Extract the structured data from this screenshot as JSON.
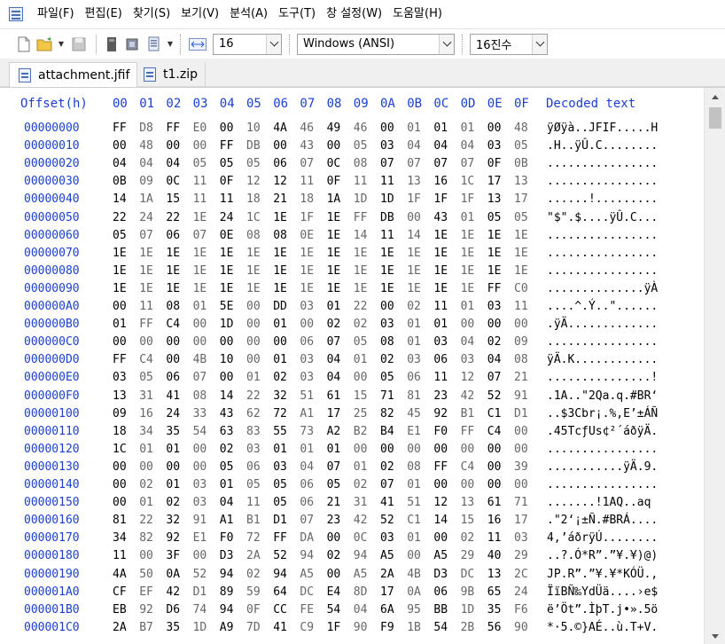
{
  "menu": [
    "파일(F)",
    "편집(E)",
    "찾기(S)",
    "보기(V)",
    "분석(A)",
    "도구(T)",
    "창 설정(W)",
    "도움말(H)"
  ],
  "toolbar": {
    "bytes_per_row": "16",
    "charset": "Windows (ANSI)",
    "offset_base": "16진수"
  },
  "tabs": [
    "attachment.jfif",
    "t1.zip"
  ],
  "hex": {
    "header": {
      "offset_label": "Offset(h)",
      "columns": [
        "00",
        "01",
        "02",
        "03",
        "04",
        "05",
        "06",
        "07",
        "08",
        "09",
        "0A",
        "0B",
        "0C",
        "0D",
        "0E",
        "0F"
      ],
      "decoded_label": "Decoded text"
    },
    "rows": [
      {
        "offset": "00000000",
        "bytes": [
          "FF",
          "D8",
          "FF",
          "E0",
          "00",
          "10",
          "4A",
          "46",
          "49",
          "46",
          "00",
          "01",
          "01",
          "01",
          "00",
          "48"
        ],
        "text": "ÿØÿà..JFIF.....H"
      },
      {
        "offset": "00000010",
        "bytes": [
          "00",
          "48",
          "00",
          "00",
          "FF",
          "DB",
          "00",
          "43",
          "00",
          "05",
          "03",
          "04",
          "04",
          "04",
          "03",
          "05"
        ],
        "text": ".H..ÿÛ.C........"
      },
      {
        "offset": "00000020",
        "bytes": [
          "04",
          "04",
          "04",
          "05",
          "05",
          "05",
          "06",
          "07",
          "0C",
          "08",
          "07",
          "07",
          "07",
          "07",
          "0F",
          "0B"
        ],
        "text": "................"
      },
      {
        "offset": "00000030",
        "bytes": [
          "0B",
          "09",
          "0C",
          "11",
          "0F",
          "12",
          "12",
          "11",
          "0F",
          "11",
          "11",
          "13",
          "16",
          "1C",
          "17",
          "13"
        ],
        "text": "................"
      },
      {
        "offset": "00000040",
        "bytes": [
          "14",
          "1A",
          "15",
          "11",
          "11",
          "18",
          "21",
          "18",
          "1A",
          "1D",
          "1D",
          "1F",
          "1F",
          "1F",
          "13",
          "17"
        ],
        "text": "......!........."
      },
      {
        "offset": "00000050",
        "bytes": [
          "22",
          "24",
          "22",
          "1E",
          "24",
          "1C",
          "1E",
          "1F",
          "1E",
          "FF",
          "DB",
          "00",
          "43",
          "01",
          "05",
          "05"
        ],
        "text": "\"$\".$....ÿÛ.C..."
      },
      {
        "offset": "00000060",
        "bytes": [
          "05",
          "07",
          "06",
          "07",
          "0E",
          "08",
          "08",
          "0E",
          "1E",
          "14",
          "11",
          "14",
          "1E",
          "1E",
          "1E",
          "1E"
        ],
        "text": "................"
      },
      {
        "offset": "00000070",
        "bytes": [
          "1E",
          "1E",
          "1E",
          "1E",
          "1E",
          "1E",
          "1E",
          "1E",
          "1E",
          "1E",
          "1E",
          "1E",
          "1E",
          "1E",
          "1E",
          "1E"
        ],
        "text": "................"
      },
      {
        "offset": "00000080",
        "bytes": [
          "1E",
          "1E",
          "1E",
          "1E",
          "1E",
          "1E",
          "1E",
          "1E",
          "1E",
          "1E",
          "1E",
          "1E",
          "1E",
          "1E",
          "1E",
          "1E"
        ],
        "text": "................"
      },
      {
        "offset": "00000090",
        "bytes": [
          "1E",
          "1E",
          "1E",
          "1E",
          "1E",
          "1E",
          "1E",
          "1E",
          "1E",
          "1E",
          "1E",
          "1E",
          "1E",
          "1E",
          "FF",
          "C0"
        ],
        "text": "..............ÿÀ"
      },
      {
        "offset": "000000A0",
        "bytes": [
          "00",
          "11",
          "08",
          "01",
          "5E",
          "00",
          "DD",
          "03",
          "01",
          "22",
          "00",
          "02",
          "11",
          "01",
          "03",
          "11"
        ],
        "text": "....^.Ý..\"......"
      },
      {
        "offset": "000000B0",
        "bytes": [
          "01",
          "FF",
          "C4",
          "00",
          "1D",
          "00",
          "01",
          "00",
          "02",
          "02",
          "03",
          "01",
          "01",
          "00",
          "00",
          "00"
        ],
        "text": ".ÿÄ............."
      },
      {
        "offset": "000000C0",
        "bytes": [
          "00",
          "00",
          "00",
          "00",
          "00",
          "00",
          "00",
          "06",
          "07",
          "05",
          "08",
          "01",
          "03",
          "04",
          "02",
          "09"
        ],
        "text": "................"
      },
      {
        "offset": "000000D0",
        "bytes": [
          "FF",
          "C4",
          "00",
          "4B",
          "10",
          "00",
          "01",
          "03",
          "04",
          "01",
          "02",
          "03",
          "06",
          "03",
          "04",
          "08"
        ],
        "text": "ÿÄ.K............"
      },
      {
        "offset": "000000E0",
        "bytes": [
          "03",
          "05",
          "06",
          "07",
          "00",
          "01",
          "02",
          "03",
          "04",
          "00",
          "05",
          "06",
          "11",
          "12",
          "07",
          "21"
        ],
        "text": "...............!"
      },
      {
        "offset": "000000F0",
        "bytes": [
          "13",
          "31",
          "41",
          "08",
          "14",
          "22",
          "32",
          "51",
          "61",
          "15",
          "71",
          "81",
          "23",
          "42",
          "52",
          "91"
        ],
        "text": ".1A..\"2Qa.q.#BR‘"
      },
      {
        "offset": "00000100",
        "bytes": [
          "09",
          "16",
          "24",
          "33",
          "43",
          "62",
          "72",
          "A1",
          "17",
          "25",
          "82",
          "45",
          "92",
          "B1",
          "C1",
          "D1"
        ],
        "text": "..$3Cbr¡.%‚E’±ÁÑ"
      },
      {
        "offset": "00000110",
        "bytes": [
          "18",
          "34",
          "35",
          "54",
          "63",
          "83",
          "55",
          "73",
          "A2",
          "B2",
          "B4",
          "E1",
          "F0",
          "FF",
          "C4",
          "00"
        ],
        "text": ".45TcƒUs¢²´áðÿÄ."
      },
      {
        "offset": "00000120",
        "bytes": [
          "1C",
          "01",
          "01",
          "00",
          "02",
          "03",
          "01",
          "01",
          "01",
          "00",
          "00",
          "00",
          "00",
          "00",
          "00",
          "00"
        ],
        "text": "................"
      },
      {
        "offset": "00000130",
        "bytes": [
          "00",
          "00",
          "00",
          "00",
          "05",
          "06",
          "03",
          "04",
          "07",
          "01",
          "02",
          "08",
          "FF",
          "C4",
          "00",
          "39",
          "11"
        ],
        "text": "...........ÿÄ.9."
      },
      {
        "offset": "00000140",
        "bytes": [
          "00",
          "02",
          "01",
          "03",
          "01",
          "05",
          "05",
          "06",
          "05",
          "02",
          "07",
          "01",
          "00",
          "00",
          "00",
          "00"
        ],
        "text": "................"
      },
      {
        "offset": "00000150",
        "bytes": [
          "00",
          "01",
          "02",
          "03",
          "04",
          "11",
          "05",
          "06",
          "21",
          "31",
          "41",
          "51",
          "12",
          "13",
          "61",
          "71"
        ],
        "text": ".......!1AQ..aq"
      },
      {
        "offset": "00000160",
        "bytes": [
          "81",
          "22",
          "32",
          "91",
          "A1",
          "B1",
          "D1",
          "07",
          "23",
          "42",
          "52",
          "C1",
          "14",
          "15",
          "16",
          "17"
        ],
        "text": ".\"2‘¡±Ñ.#BRÁ...."
      },
      {
        "offset": "00000170",
        "bytes": [
          "34",
          "82",
          "92",
          "E1",
          "F0",
          "72",
          "FF",
          "DA",
          "00",
          "0C",
          "03",
          "01",
          "00",
          "02",
          "11",
          "03"
        ],
        "text": "4‚’áðrÿÚ........"
      },
      {
        "offset": "00000180",
        "bytes": [
          "11",
          "00",
          "3F",
          "00",
          "D3",
          "2A",
          "52",
          "94",
          "02",
          "94",
          "A5",
          "00",
          "A5",
          "29",
          "40",
          "29"
        ],
        "text": "..?.Ó*R”.”¥.¥)@)"
      },
      {
        "offset": "00000190",
        "bytes": [
          "4A",
          "50",
          "0A",
          "52",
          "94",
          "02",
          "94",
          "A5",
          "00",
          "A5",
          "2A",
          "4B",
          "D3",
          "DC",
          "13",
          "2C"
        ],
        "text": "JP.R”.”¥.¥*KÓÜ.,"
      },
      {
        "offset": "000001A0",
        "bytes": [
          "CF",
          "EF",
          "42",
          "D1",
          "89",
          "59",
          "64",
          "DC",
          "E4",
          "8D",
          "17",
          "0A",
          "06",
          "9B",
          "65",
          "24"
        ],
        "text": "ÏïBÑ‰YdÜä....›e$"
      },
      {
        "offset": "000001B0",
        "bytes": [
          "EB",
          "92",
          "D6",
          "74",
          "94",
          "0F",
          "CC",
          "FE",
          "54",
          "04",
          "6A",
          "95",
          "BB",
          "1D",
          "35",
          "F6"
        ],
        "text": "ë’Öt”.ÌþT.j•».5ö"
      },
      {
        "offset": "000001C0",
        "bytes": [
          "2A",
          "B7",
          "35",
          "1D",
          "A9",
          "7D",
          "41",
          "C9",
          "1F",
          "90",
          "F9",
          "1B",
          "54",
          "2B",
          "56",
          "90"
        ],
        "text": "*·5.©}AÉ..ù.T+V."
      }
    ]
  }
}
